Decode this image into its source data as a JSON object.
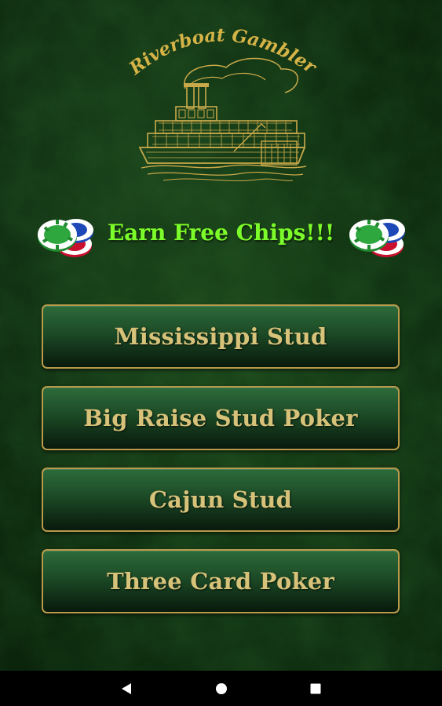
{
  "logo": {
    "title": "Riverboat Gambler"
  },
  "promo": {
    "text": "Earn Free Chips!!!",
    "chips_left_icon": "poker-chips-icon",
    "chips_right_icon": "poker-chips-icon"
  },
  "menu": {
    "items": [
      {
        "label": "Mississippi Stud"
      },
      {
        "label": "Big Raise Stud Poker"
      },
      {
        "label": "Cajun Stud"
      },
      {
        "label": "Three Card Poker"
      }
    ]
  },
  "navbar": {
    "back_icon": "back-triangle-icon",
    "home_icon": "home-circle-icon",
    "recent_icon": "recent-apps-square-icon"
  },
  "colors": {
    "felt": "#123812",
    "gold": "#d4b347",
    "promo_green": "#7cfc2a",
    "button_border": "#b89a4a",
    "button_text": "#d7c27a"
  }
}
